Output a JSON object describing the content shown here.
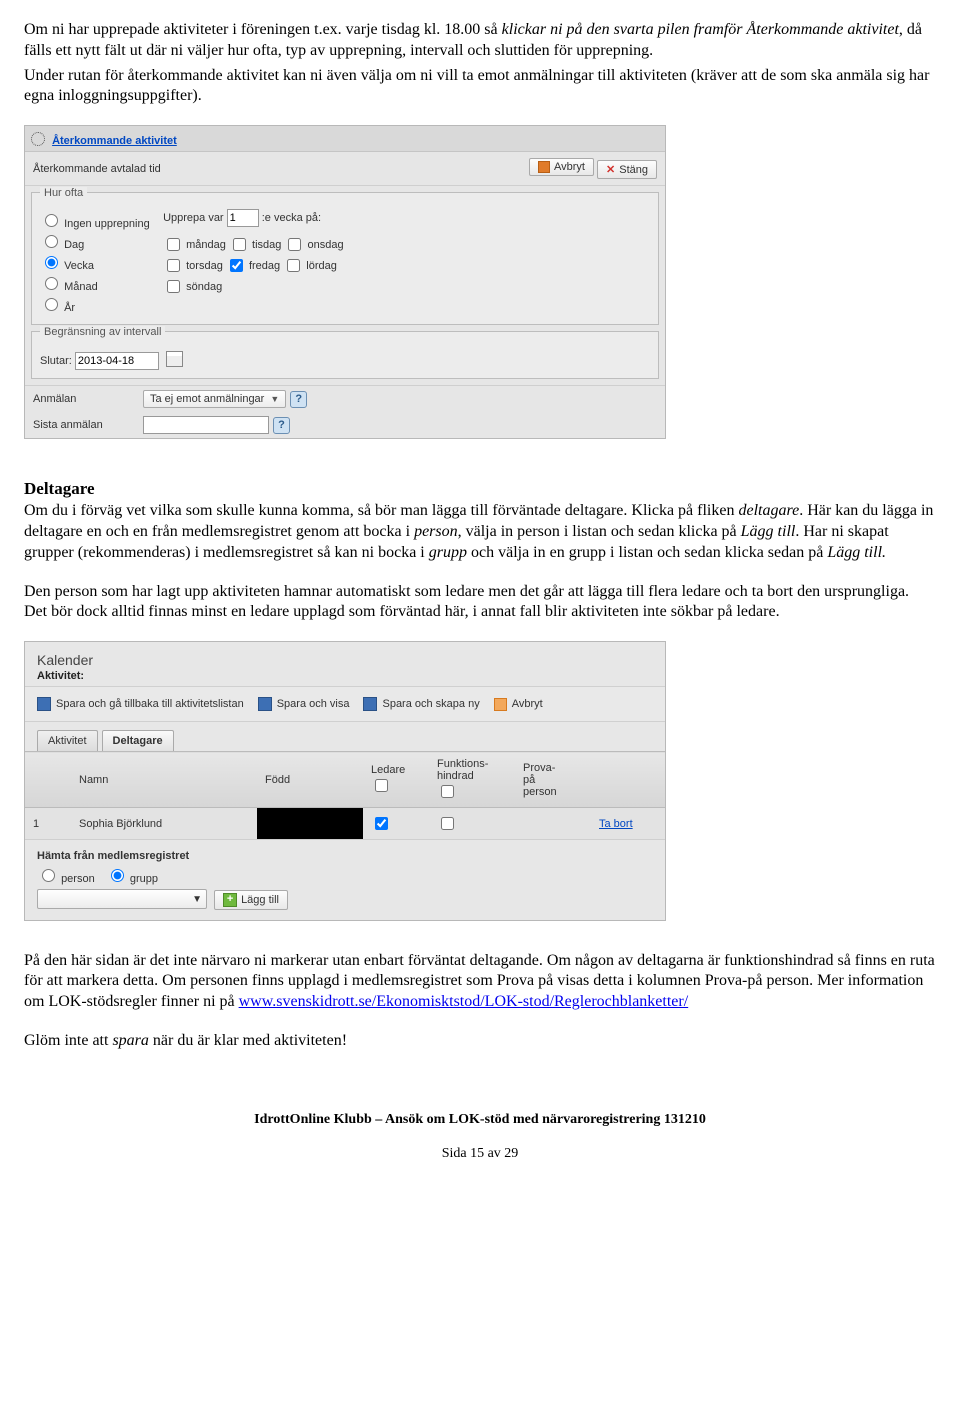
{
  "intro": {
    "p1a": "Om ni har upprepade aktiviteter i föreningen t.ex. varje tisdag kl. 18.00 så ",
    "p1b": "klickar ni på den svarta pilen framför Återkommande aktivitet",
    "p1c": ", då fälls ett nytt fält ut där ni väljer hur ofta, typ av upprepning, intervall och sluttiden för upprepning.",
    "p2": "Under rutan för återkommande aktivitet kan ni även välja om ni vill ta emot anmälningar till aktiviteten (kräver att de som ska anmäla sig har egna inloggningsuppgifter)."
  },
  "ui1": {
    "header_link": "Återkommande aktivitet",
    "avtalad": "Återkommande avtalad tid",
    "btn_avbryt": "Avbryt",
    "btn_stang": "Stäng",
    "hur_ofta": "Hur ofta",
    "radios": {
      "ingen": "Ingen upprepning",
      "dag": "Dag",
      "vecka": "Vecka",
      "manad": "Månad",
      "ar": "År"
    },
    "upprepa_pre": "Upprepa var",
    "upprepa_val": "1",
    "upprepa_post": ":e vecka på:",
    "days": {
      "mandag": "måndag",
      "tisdag": "tisdag",
      "onsdag": "onsdag",
      "torsdag": "torsdag",
      "fredag": "fredag",
      "lordag": "lördag",
      "sondag": "söndag"
    },
    "begr": "Begränsning av intervall",
    "slutar": "Slutar:",
    "slutar_date": "2013-04-18",
    "anmalan": "Anmälan",
    "anmalan_select": "Ta ej emot anmälningar",
    "sista": "Sista anmälan"
  },
  "deltagare": {
    "heading": "Deltagare",
    "p1a": "Om du i förväg vet vilka som skulle kunna komma, så bör man lägga till förväntade deltagare. Klicka på fliken ",
    "p1b": "deltagare",
    "p1c": ". Här kan du lägga in deltagare en och en från medlemsregistret genom att bocka i ",
    "p1d": "person",
    "p1e": ", välja in person i listan och sedan klicka på ",
    "p1f": "Lägg till",
    "p1g": ". Har ni skapat grupper (rekommenderas) i medlemsregistret så kan ni bocka i ",
    "p1h": "grupp",
    "p1i": " och välja in en grupp i listan och sedan klicka sedan på ",
    "p1j": "Lägg till.",
    "p2": "Den person som har lagt upp aktiviteten hamnar automatiskt som ledare men det går att lägga till flera ledare och ta bort den ursprungliga. Det bör dock alltid finnas minst en ledare upplagd som förväntad här, i annat fall blir aktiviteten inte sökbar på ledare."
  },
  "ui2": {
    "kalender": "Kalender",
    "aktivitet": "Aktivitet:",
    "bar": {
      "spara_back": "Spara och gå tillbaka till aktivitetslistan",
      "spara_visa": "Spara och visa",
      "spara_ny": "Spara och skapa ny",
      "avbryt": "Avbryt"
    },
    "tabs": {
      "aktivitet": "Aktivitet",
      "deltagare": "Deltagare"
    },
    "cols": {
      "num": "",
      "namn": "Namn",
      "fodd": "Född",
      "ledare": "Ledare",
      "funkt": "Funktions-\nhindrad",
      "prova": "Prova-\npå\nperson"
    },
    "row1": {
      "num": "1",
      "namn": "Sophia Björklund",
      "remove": "Ta bort"
    },
    "bottom": {
      "lbl": "Hämta från medlemsregistret",
      "person": "person",
      "grupp": "grupp",
      "add": "Lägg till"
    }
  },
  "after": {
    "p1a": "På den här sidan är det inte närvaro ni markerar utan enbart förväntat deltagande. Om någon av deltagarna är funktionshindrad så finns en ruta för att markera detta. Om personen finns upplagd i medlemsregistret som Prova på visas detta i kolumnen Prova-på person. Mer information om LOK-stödsregler finner ni på ",
    "link_text": "www.svenskidrott.se/Ekonomisktstod/LOK-stod/Reglerochblanketter/",
    "p2a": "Glöm inte att ",
    "p2b": "spara",
    "p2c": " när du är klar med aktiviteten!"
  },
  "footer": {
    "line1": "IdrottOnline Klubb – Ansök om LOK-stöd med närvaroregistrering 131210",
    "line2a": "Sida ",
    "line2b": "15",
    "line2c": " av ",
    "line2d": "29"
  }
}
